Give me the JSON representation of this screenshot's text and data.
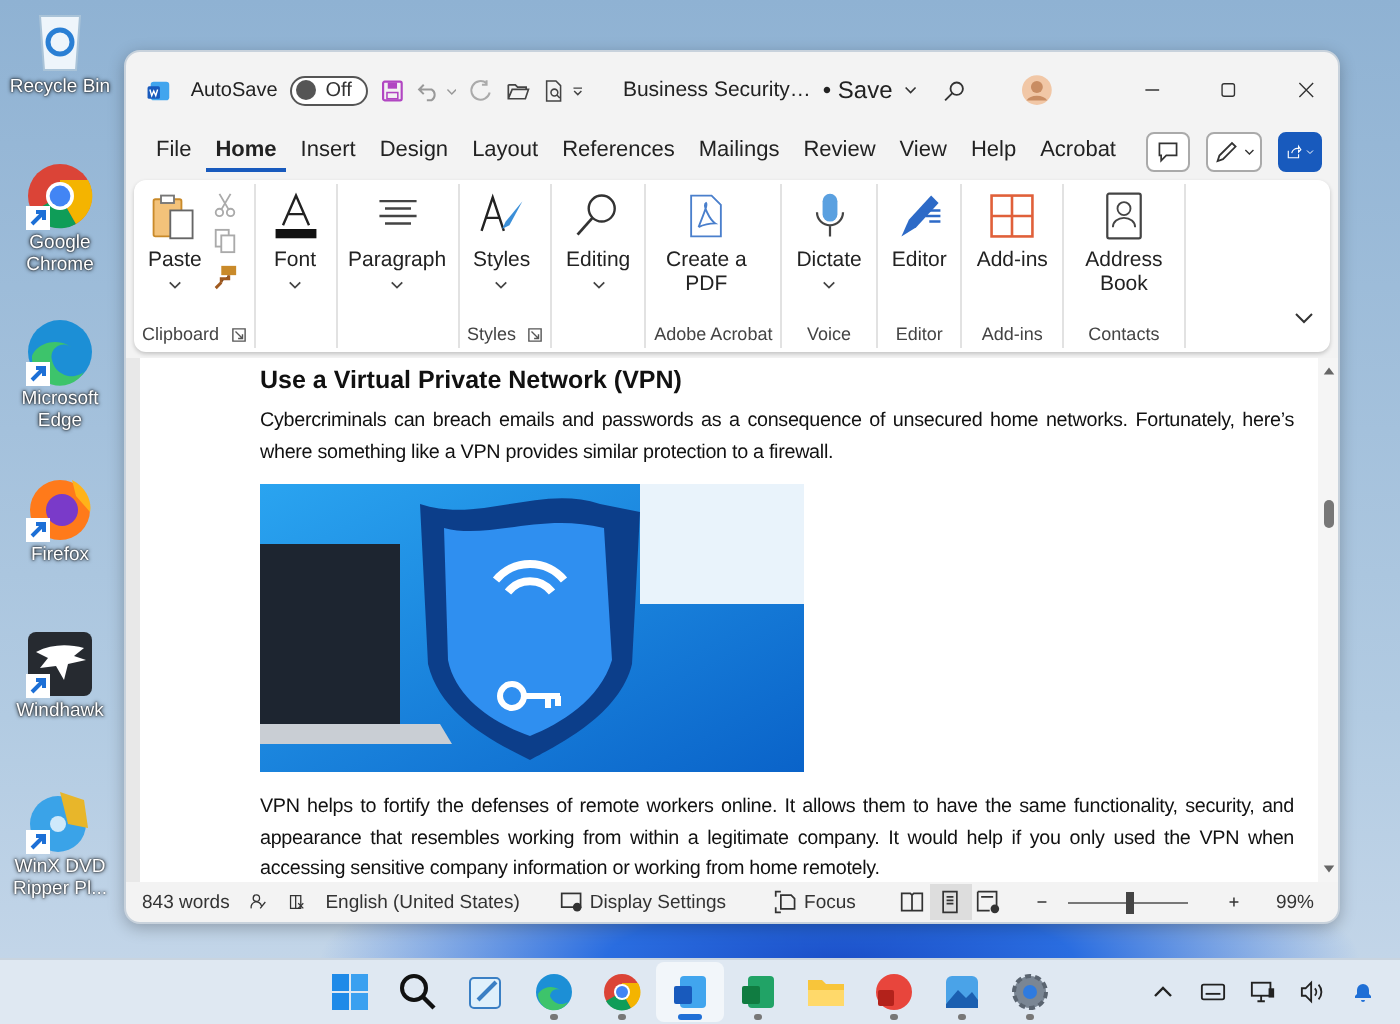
{
  "desktop": {
    "icons": [
      {
        "label": "Recycle Bin",
        "kind": "recycle",
        "shortcut": false
      },
      {
        "label": "Google Chrome",
        "kind": "chrome",
        "shortcut": true
      },
      {
        "label": "Microsoft Edge",
        "kind": "edge",
        "shortcut": true
      },
      {
        "label": "Firefox",
        "kind": "firefox",
        "shortcut": true
      },
      {
        "label": "Windhawk",
        "kind": "windhawk",
        "shortcut": true
      },
      {
        "label": "WinX DVD Ripper Pl...",
        "kind": "winx",
        "shortcut": true
      }
    ]
  },
  "window": {
    "autosave": {
      "label": "AutoSave",
      "on": false,
      "state_text": "Off"
    },
    "title": "Business Security…",
    "save_status": "• Save"
  },
  "tabs": [
    {
      "label": "File",
      "selected": false
    },
    {
      "label": "Home",
      "selected": true
    },
    {
      "label": "Insert",
      "selected": false
    },
    {
      "label": "Design",
      "selected": false
    },
    {
      "label": "Layout",
      "selected": false
    },
    {
      "label": "References",
      "selected": false
    },
    {
      "label": "Mailings",
      "selected": false
    },
    {
      "label": "Review",
      "selected": false
    },
    {
      "label": "View",
      "selected": false
    },
    {
      "label": "Help",
      "selected": false
    },
    {
      "label": "Acrobat",
      "selected": false
    }
  ],
  "ribbon": {
    "groups": [
      {
        "label": "Clipboard",
        "launcher": true,
        "buttons": [
          {
            "label": "Paste",
            "kind": "paste",
            "dropdown": true
          }
        ],
        "small_tools": [
          {
            "kind": "cut",
            "disabled": true
          },
          {
            "kind": "copy",
            "disabled": true
          },
          {
            "kind": "painter",
            "disabled": false
          }
        ]
      },
      {
        "launcher": false,
        "buttons": [
          {
            "label": "Font",
            "kind": "font",
            "dropdown": true
          }
        ]
      },
      {
        "launcher": false,
        "buttons": [
          {
            "label": "Paragraph",
            "kind": "paragraph",
            "dropdown": true
          }
        ]
      },
      {
        "label": "Styles",
        "launcher": true,
        "buttons": [
          {
            "label": "Styles",
            "kind": "styles",
            "dropdown": true
          }
        ]
      },
      {
        "launcher": false,
        "buttons": [
          {
            "label": "Editing",
            "kind": "editing",
            "dropdown": true
          }
        ]
      },
      {
        "label": "Adobe Acrobat",
        "launcher": false,
        "buttons": [
          {
            "label": "Create a PDF",
            "kind": "pdf",
            "dropdown": false
          }
        ]
      },
      {
        "label": "Voice",
        "launcher": false,
        "buttons": [
          {
            "label": "Dictate",
            "kind": "dictate",
            "dropdown": true
          }
        ]
      },
      {
        "label": "Editor",
        "launcher": false,
        "buttons": [
          {
            "label": "Editor",
            "kind": "editor",
            "dropdown": false
          }
        ]
      },
      {
        "label": "Add-ins",
        "launcher": false,
        "buttons": [
          {
            "label": "Add-ins",
            "kind": "addins",
            "dropdown": false
          }
        ]
      },
      {
        "label": "Contacts",
        "launcher": false,
        "buttons": [
          {
            "label": "Address Book",
            "kind": "contacts",
            "dropdown": false
          }
        ]
      }
    ]
  },
  "document": {
    "blocks": [
      {
        "kind": "heading",
        "text": "Use a Virtual Private Network (VPN)"
      },
      {
        "kind": "paragraph",
        "text": "Cybercriminals can breach emails and passwords as a consequence of unsecured home networks. Fortunately, here’s where something like a VPN provides similar protection to a firewall."
      },
      {
        "kind": "image"
      },
      {
        "kind": "paragraph",
        "text": "VPN helps to fortify the defenses of remote workers online. It allows them to have the same functionality, security, and appearance that resembles working from within a legitimate company. It would help if you only used the VPN when accessing sensitive company information or working from home remotely."
      }
    ]
  },
  "status_bar": {
    "word_count": "843 words",
    "language": "English (United States)",
    "display_settings": "Display Settings",
    "focus": "Focus",
    "views": [
      {
        "kind": "read",
        "selected": false
      },
      {
        "kind": "print",
        "selected": true
      },
      {
        "kind": "web",
        "selected": false
      }
    ],
    "zoom": {
      "level": 0.51,
      "reading": "99%"
    }
  },
  "taskbar": {
    "apps": [
      {
        "kind": "start",
        "selected": false,
        "running": false
      },
      {
        "kind": "search",
        "selected": false,
        "running": false
      },
      {
        "kind": "notepad",
        "selected": false,
        "running": false
      },
      {
        "kind": "edge",
        "selected": false,
        "running": true
      },
      {
        "kind": "chrome",
        "selected": false,
        "running": true
      },
      {
        "kind": "word",
        "selected": true,
        "running": true
      },
      {
        "kind": "excel",
        "selected": false,
        "running": true
      },
      {
        "kind": "folder",
        "selected": false,
        "running": false
      },
      {
        "kind": "acrobat",
        "selected": false,
        "running": true
      },
      {
        "kind": "photos",
        "selected": false,
        "running": true
      },
      {
        "kind": "settings",
        "selected": false,
        "running": true
      }
    ]
  }
}
